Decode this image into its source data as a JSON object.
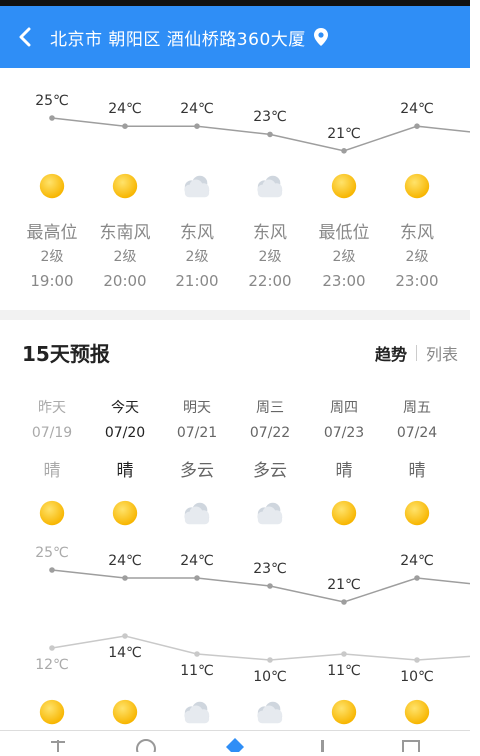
{
  "header": {
    "back_icon": "chevron-left-icon",
    "location": "北京市 朝阳区 酒仙桥路360大厦",
    "location_icon": "location-pin-icon",
    "background_color": "#2f8ef6"
  },
  "hourly": {
    "items": [
      {
        "temp": "25℃",
        "temp_value": 25,
        "icon": "sunny-icon",
        "wind": "最高位",
        "level": "2级",
        "time": "19:00"
      },
      {
        "temp": "24℃",
        "temp_value": 24,
        "icon": "sunny-icon",
        "wind": "东南风",
        "level": "2级",
        "time": "20:00"
      },
      {
        "temp": "24℃",
        "temp_value": 24,
        "icon": "cloudy-icon",
        "wind": "东风",
        "level": "2级",
        "time": "21:00"
      },
      {
        "temp": "23℃",
        "temp_value": 23,
        "icon": "cloudy-icon",
        "wind": "东风",
        "level": "2级",
        "time": "22:00"
      },
      {
        "temp": "21℃",
        "temp_value": 21,
        "icon": "sunny-icon",
        "wind": "最低位",
        "level": "2级",
        "time": "23:00"
      },
      {
        "temp": "24℃",
        "temp_value": 24,
        "icon": "sunny-icon",
        "wind": "东风",
        "level": "2级",
        "time": "23:00"
      }
    ]
  },
  "forecast": {
    "title": "15天预报",
    "tab_trend": "趋势",
    "tab_list": "列表",
    "days": [
      {
        "name": "昨天",
        "date": "07/19",
        "cond": "晴",
        "icon": "sunny-icon",
        "high": "25℃",
        "high_value": 25,
        "low": "12℃",
        "low_value": 12,
        "state": "past"
      },
      {
        "name": "今天",
        "date": "07/20",
        "cond": "晴",
        "icon": "sunny-icon",
        "high": "24℃",
        "high_value": 24,
        "low": "14℃",
        "low_value": 14,
        "state": "now"
      },
      {
        "name": "明天",
        "date": "07/21",
        "cond": "多云",
        "icon": "cloudy-icon",
        "high": "24℃",
        "high_value": 24,
        "low": "11℃",
        "low_value": 11,
        "state": "future"
      },
      {
        "name": "周三",
        "date": "07/22",
        "cond": "多云",
        "icon": "cloudy-icon",
        "high": "23℃",
        "high_value": 23,
        "low": "10℃",
        "low_value": 10,
        "state": "future"
      },
      {
        "name": "周四",
        "date": "07/23",
        "cond": "晴",
        "icon": "sunny-icon",
        "high": "21℃",
        "high_value": 21,
        "low": "11℃",
        "low_value": 11,
        "state": "future"
      },
      {
        "name": "周五",
        "date": "07/24",
        "cond": "晴",
        "icon": "sunny-icon",
        "high": "24℃",
        "high_value": 24,
        "low": "10℃",
        "low_value": 10,
        "state": "future"
      }
    ],
    "bottom_icons": [
      "sunny-icon",
      "sunny-icon",
      "cloudy-icon",
      "cloudy-icon",
      "sunny-icon",
      "sunny-icon"
    ]
  },
  "bottom_nav": {
    "items": [
      {
        "icon": "home-icon"
      },
      {
        "icon": "compass-icon"
      },
      {
        "icon": "weather-icon"
      },
      {
        "icon": "chart-icon"
      },
      {
        "icon": "box-icon"
      }
    ]
  }
}
